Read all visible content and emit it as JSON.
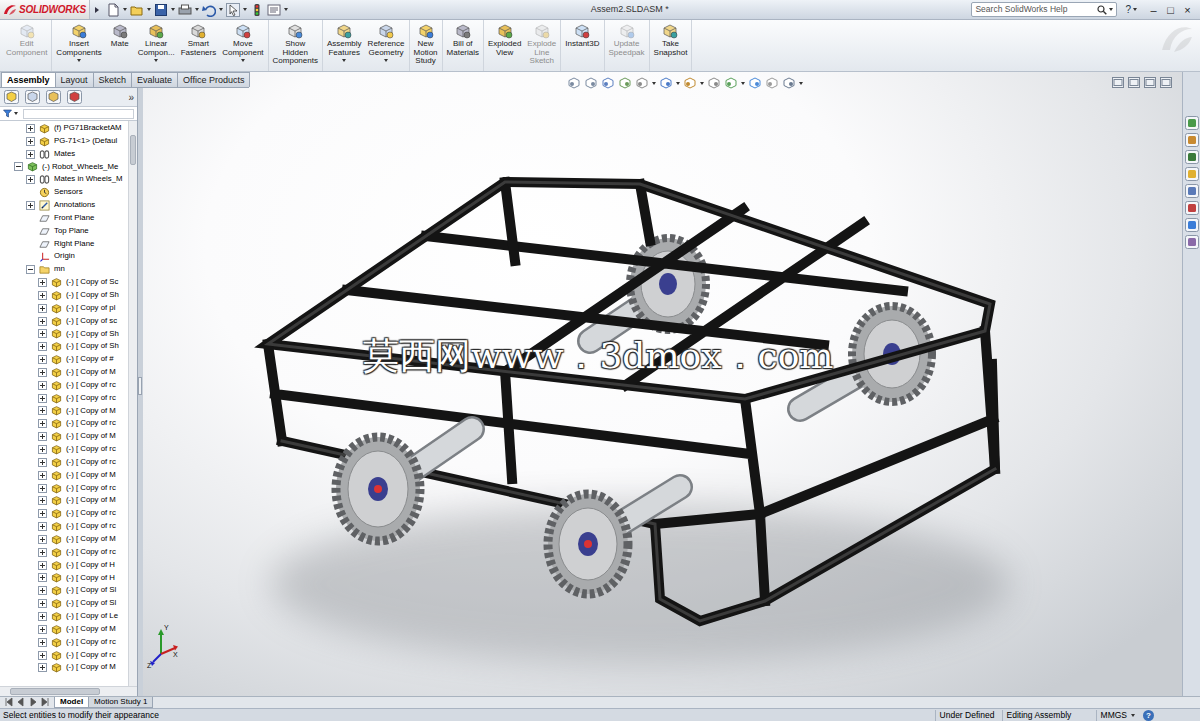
{
  "window": {
    "brand": "SOLIDWORKS",
    "title": "Assem2.SLDASM *",
    "help": "?",
    "controls": [
      "–",
      "□",
      "×"
    ]
  },
  "search": {
    "placeholder": "Search SolidWorks Help"
  },
  "ribbon": [
    {
      "buttons": [
        {
          "lines": [
            "Edit",
            "Component"
          ],
          "disabled": true,
          "menu": false
        }
      ]
    },
    {
      "buttons": [
        {
          "lines": [
            "Insert",
            "Components"
          ],
          "disabled": false,
          "menu": true
        },
        {
          "lines": [
            "Mate"
          ],
          "disabled": false,
          "menu": false
        },
        {
          "lines": [
            "Linear",
            "Compon..."
          ],
          "disabled": false,
          "menu": true
        },
        {
          "lines": [
            "Smart",
            "Fasteners"
          ],
          "disabled": false,
          "menu": false
        },
        {
          "lines": [
            "Move",
            "Component"
          ],
          "disabled": false,
          "menu": true
        }
      ]
    },
    {
      "buttons": [
        {
          "lines": [
            "Show",
            "Hidden",
            "Components"
          ],
          "disabled": false,
          "menu": false
        }
      ]
    },
    {
      "buttons": [
        {
          "lines": [
            "Assembly",
            "Features"
          ],
          "disabled": false,
          "menu": true
        },
        {
          "lines": [
            "Reference",
            "Geometry"
          ],
          "disabled": false,
          "menu": true
        }
      ]
    },
    {
      "buttons": [
        {
          "lines": [
            "New",
            "Motion",
            "Study"
          ],
          "disabled": false,
          "menu": false
        }
      ]
    },
    {
      "buttons": [
        {
          "lines": [
            "Bill of",
            "Materials"
          ],
          "disabled": false,
          "menu": false
        }
      ]
    },
    {
      "buttons": [
        {
          "lines": [
            "Exploded",
            "View"
          ],
          "disabled": false,
          "menu": false
        },
        {
          "lines": [
            "Explode",
            "Line",
            "Sketch"
          ],
          "disabled": true,
          "menu": false
        }
      ]
    },
    {
      "buttons": [
        {
          "lines": [
            "Instant3D"
          ],
          "disabled": false,
          "menu": false
        }
      ]
    },
    {
      "buttons": [
        {
          "lines": [
            "Update",
            "Speedpak"
          ],
          "disabled": true,
          "menu": false
        }
      ]
    },
    {
      "buttons": [
        {
          "lines": [
            "Take",
            "Snapshot"
          ],
          "disabled": false,
          "menu": false
        }
      ]
    }
  ],
  "tabs": [
    {
      "label": "Assembly",
      "selected": true
    },
    {
      "label": "Layout",
      "selected": false
    },
    {
      "label": "Sketch",
      "selected": false
    },
    {
      "label": "Evaluate",
      "selected": false
    },
    {
      "label": "Office Products",
      "selected": false
    }
  ],
  "panel": {
    "more": "»"
  },
  "tree": [
    {
      "label": "(f) PG71BracketAM",
      "depth": 1,
      "kind": "part",
      "expandable": true,
      "expanded": false
    },
    {
      "label": "PG-71<1> (Defaul",
      "depth": 1,
      "kind": "part",
      "expandable": true,
      "expanded": false
    },
    {
      "label": "Mates",
      "depth": 1,
      "kind": "mates",
      "expandable": true,
      "expanded": false
    },
    {
      "label": "(-) Robot_Wheels_Me",
      "depth": 0,
      "kind": "assembly",
      "expandable": true,
      "expanded": true
    },
    {
      "label": "Mates in Wheels_M",
      "depth": 1,
      "kind": "mates",
      "expandable": true,
      "expanded": false
    },
    {
      "label": "Sensors",
      "depth": 1,
      "kind": "sensor",
      "expandable": false,
      "expanded": false
    },
    {
      "label": "Annotations",
      "depth": 1,
      "kind": "annotation",
      "expandable": true,
      "expanded": false
    },
    {
      "label": "Front Plane",
      "depth": 1,
      "kind": "plane",
      "expandable": false,
      "expanded": false
    },
    {
      "label": "Top Plane",
      "depth": 1,
      "kind": "plane",
      "expandable": false,
      "expanded": false
    },
    {
      "label": "Right Plane",
      "depth": 1,
      "kind": "plane",
      "expandable": false,
      "expanded": false
    },
    {
      "label": "Origin",
      "depth": 1,
      "kind": "origin",
      "expandable": false,
      "expanded": false
    },
    {
      "label": "mn",
      "depth": 1,
      "kind": "folder",
      "expandable": true,
      "expanded": true
    },
    {
      "label": "(-) [ Copy of Sc",
      "depth": 2,
      "kind": "part",
      "expandable": true,
      "expanded": false
    },
    {
      "label": "(-) [ Copy of Sh",
      "depth": 2,
      "kind": "part",
      "expandable": true,
      "expanded": false
    },
    {
      "label": "(-) [ Copy of pl",
      "depth": 2,
      "kind": "part",
      "expandable": true,
      "expanded": false
    },
    {
      "label": "(-) [ Copy of sc",
      "depth": 2,
      "kind": "part",
      "expandable": true,
      "expanded": false
    },
    {
      "label": "(-) [ Copy of Sh",
      "depth": 2,
      "kind": "part",
      "expandable": true,
      "expanded": false
    },
    {
      "label": "(-) [ Copy of Sh",
      "depth": 2,
      "kind": "part",
      "expandable": true,
      "expanded": false
    },
    {
      "label": "(-) [ Copy of #",
      "depth": 2,
      "kind": "part",
      "expandable": true,
      "expanded": false
    },
    {
      "label": "(-) [ Copy of M",
      "depth": 2,
      "kind": "part",
      "expandable": true,
      "expanded": false
    },
    {
      "label": "(-) [ Copy of rc",
      "depth": 2,
      "kind": "part",
      "expandable": true,
      "expanded": false
    },
    {
      "label": "(-) [ Copy of rc",
      "depth": 2,
      "kind": "part",
      "expandable": true,
      "expanded": false
    },
    {
      "label": "(-) [ Copy of M",
      "depth": 2,
      "kind": "part",
      "expandable": true,
      "expanded": false
    },
    {
      "label": "(-) [ Copy of rc",
      "depth": 2,
      "kind": "part",
      "expandable": true,
      "expanded": false
    },
    {
      "label": "(-) [ Copy of M",
      "depth": 2,
      "kind": "part",
      "expandable": true,
      "expanded": false
    },
    {
      "label": "(-) [ Copy of rc",
      "depth": 2,
      "kind": "part",
      "expandable": true,
      "expanded": false
    },
    {
      "label": "(-) [ Copy of rc",
      "depth": 2,
      "kind": "part",
      "expandable": true,
      "expanded": false
    },
    {
      "label": "(-) [ Copy of M",
      "depth": 2,
      "kind": "part",
      "expandable": true,
      "expanded": false
    },
    {
      "label": "(-) [ Copy of rc",
      "depth": 2,
      "kind": "part",
      "expandable": true,
      "expanded": false
    },
    {
      "label": "(-) [ Copy of M",
      "depth": 2,
      "kind": "part",
      "expandable": true,
      "expanded": false
    },
    {
      "label": "(-) [ Copy of rc",
      "depth": 2,
      "kind": "part",
      "expandable": true,
      "expanded": false
    },
    {
      "label": "(-) [ Copy of rc",
      "depth": 2,
      "kind": "part",
      "expandable": true,
      "expanded": false
    },
    {
      "label": "(-) [ Copy of M",
      "depth": 2,
      "kind": "part",
      "expandable": true,
      "expanded": false
    },
    {
      "label": "(-) [ Copy of rc",
      "depth": 2,
      "kind": "part",
      "expandable": true,
      "expanded": false
    },
    {
      "label": "(-) [ Copy of H",
      "depth": 2,
      "kind": "part",
      "expandable": true,
      "expanded": false
    },
    {
      "label": "(-) [ Copy of H",
      "depth": 2,
      "kind": "part",
      "expandable": true,
      "expanded": false
    },
    {
      "label": "(-) [ Copy of Sl",
      "depth": 2,
      "kind": "part",
      "expandable": true,
      "expanded": false
    },
    {
      "label": "(-) [ Copy of Sl",
      "depth": 2,
      "kind": "part",
      "expandable": true,
      "expanded": false
    },
    {
      "label": "(-) [ Copy of Le",
      "depth": 2,
      "kind": "part",
      "expandable": true,
      "expanded": false
    },
    {
      "label": "(-) [ Copy of M",
      "depth": 2,
      "kind": "part",
      "expandable": true,
      "expanded": false
    },
    {
      "label": "(-) [ Copy of rc",
      "depth": 2,
      "kind": "part",
      "expandable": true,
      "expanded": false
    },
    {
      "label": "(-) [ Copy of rc",
      "depth": 2,
      "kind": "part",
      "expandable": true,
      "expanded": false
    },
    {
      "label": "(-) [ Copy of M",
      "depth": 2,
      "kind": "part",
      "expandable": true,
      "expanded": false
    }
  ],
  "viewport": {
    "watermark": "莫西网www．3dmox．com",
    "triad": [
      "Y",
      "X",
      "Z"
    ]
  },
  "model_tabs": [
    {
      "label": "Model",
      "selected": true
    },
    {
      "label": "Motion Study 1",
      "selected": false
    }
  ],
  "status_bar": {
    "message": "Select entities to modify their appearance",
    "fields": [
      "Under Defined",
      "Editing Assembly",
      "MMGS"
    ],
    "help": "?"
  }
}
